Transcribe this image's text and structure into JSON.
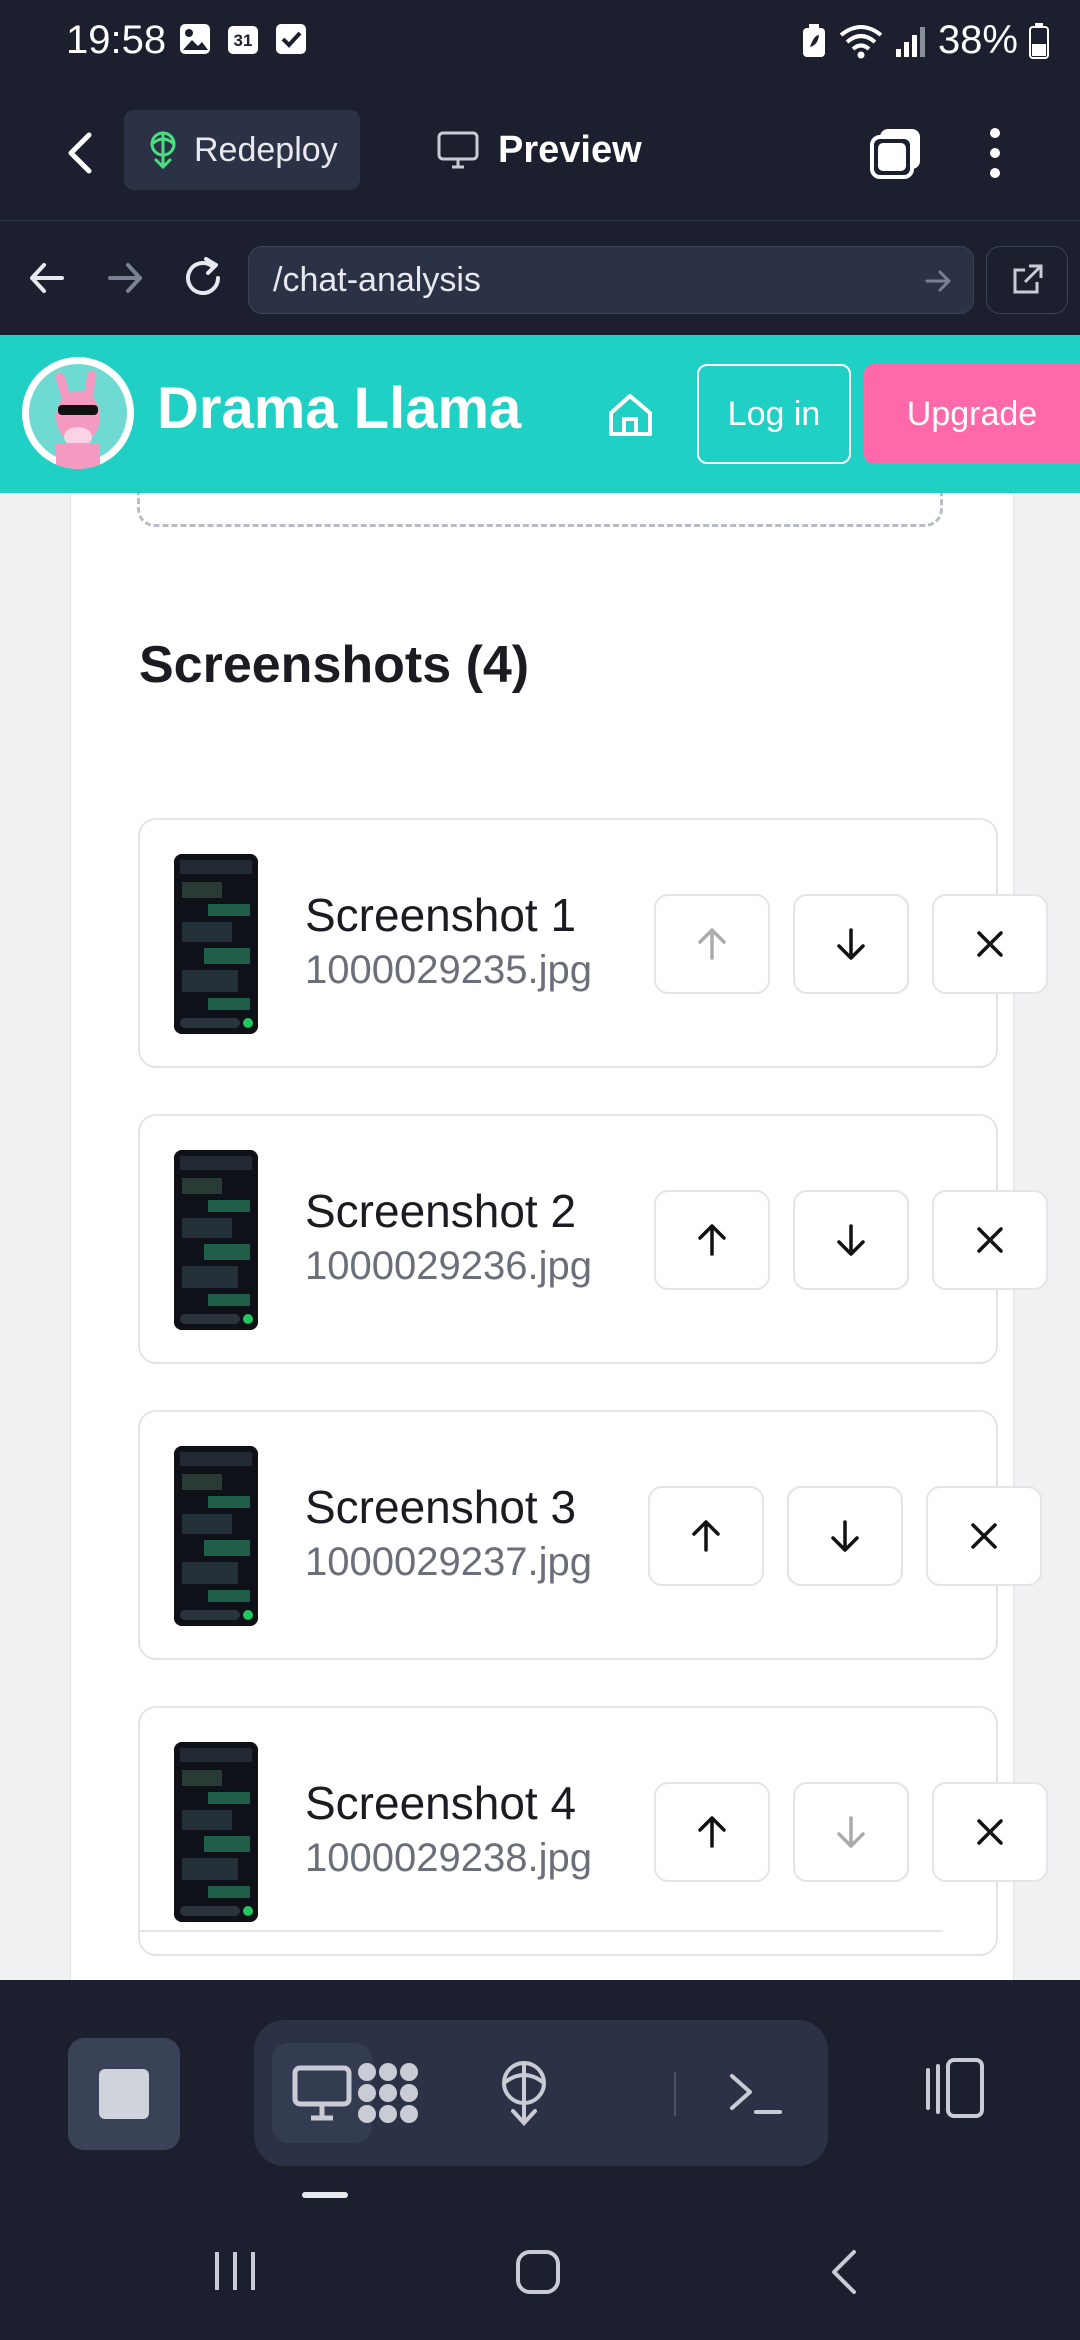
{
  "status_bar": {
    "time": "19:58",
    "calendar_day": "31",
    "battery": "38%"
  },
  "workspace_bar": {
    "redeploy_label": "Redeploy",
    "preview_label": "Preview"
  },
  "url_bar": {
    "url": "/chat-analysis"
  },
  "app": {
    "brand": "Drama Llama",
    "login_label": "Log in",
    "upgrade_label": "Upgrade",
    "accent_color": "#21d0c4",
    "upgrade_color": "#ff69a9"
  },
  "screenshots": {
    "title": "Screenshots (4)",
    "items": [
      {
        "name": "Screenshot 1",
        "file": "1000029235.jpg",
        "up_enabled": false,
        "down_enabled": true
      },
      {
        "name": "Screenshot 2",
        "file": "1000029236.jpg",
        "up_enabled": true,
        "down_enabled": true
      },
      {
        "name": "Screenshot 3",
        "file": "1000029237.jpg",
        "up_enabled": true,
        "down_enabled": true
      },
      {
        "name": "Screenshot 4",
        "file": "1000029238.jpg",
        "up_enabled": true,
        "down_enabled": false
      }
    ]
  },
  "icons": [
    "image-icon",
    "calendar-icon",
    "checkbox-icon",
    "battery-saver-icon",
    "wifi-icon",
    "signal-icon",
    "battery-icon",
    "back-chevron-icon",
    "deploy-icon",
    "monitor-icon",
    "tabs-icon",
    "kebab-menu-icon",
    "arrow-left-icon",
    "arrow-right-icon",
    "reload-icon",
    "external-link-icon",
    "home-icon",
    "arrow-up-icon",
    "arrow-down-icon",
    "close-icon",
    "stop-icon",
    "apps-icon",
    "terminal-icon",
    "layout-icon"
  ]
}
